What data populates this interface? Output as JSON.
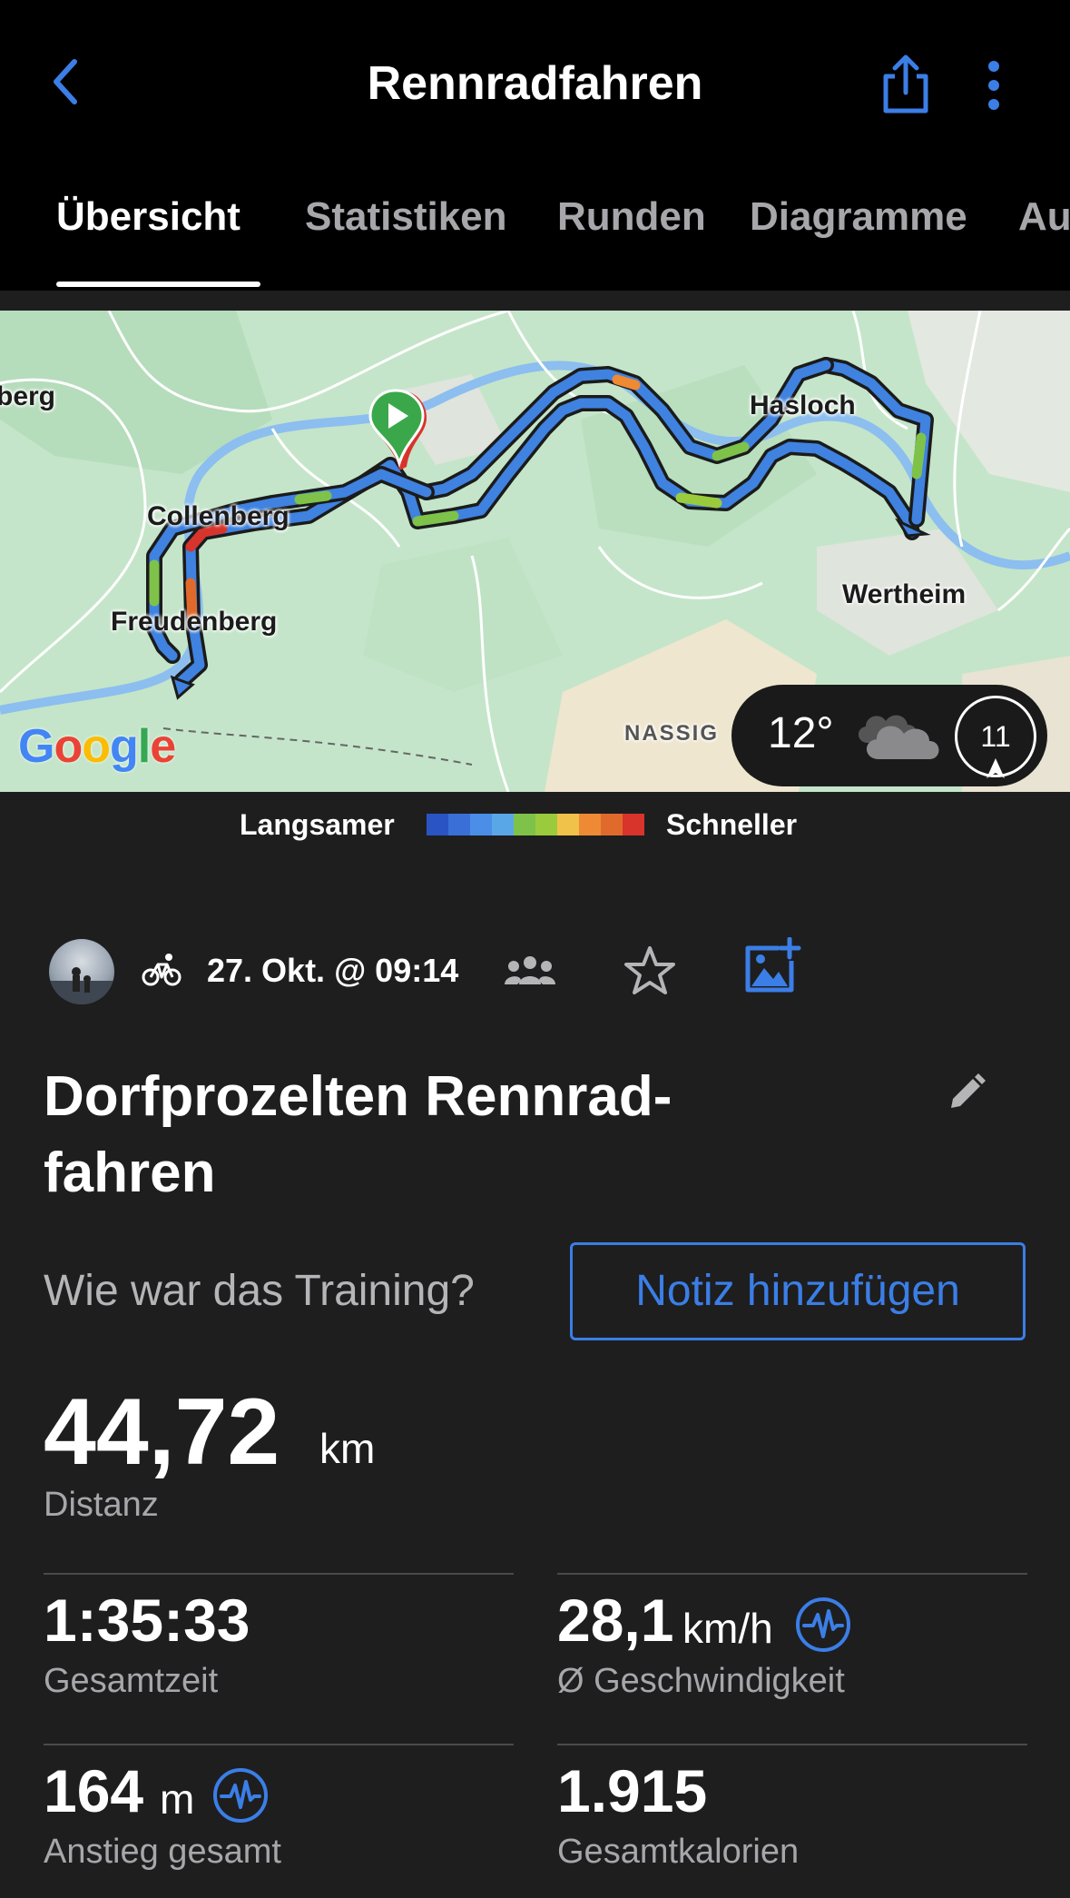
{
  "header": {
    "title": "Rennradfahren"
  },
  "tabs": [
    {
      "label": "Übersicht",
      "active": true
    },
    {
      "label": "Statistiken",
      "active": false
    },
    {
      "label": "Runden",
      "active": false
    },
    {
      "label": "Diagramme",
      "active": false
    },
    {
      "label": "Au",
      "active": false
    }
  ],
  "map": {
    "places": [
      "berg",
      "Collenberg",
      "Freudenberg",
      "Hasloch",
      "Wertheim",
      "NASSIG"
    ],
    "attribution": "Google",
    "weather": {
      "temperature": "12°",
      "wind": "11",
      "icon": "cloud-icon"
    }
  },
  "legend": {
    "slow_label": "Langsamer",
    "fast_label": "Schneller",
    "colors": [
      "#2a54c4",
      "#3a6fd8",
      "#4a8ee8",
      "#5aa7e8",
      "#7fc24a",
      "#9acb3c",
      "#f0c24a",
      "#ee8a34",
      "#e06a2c",
      "#d8342c"
    ]
  },
  "activity": {
    "date": "27. Okt. @ 09:14",
    "name": "Dorfprozelten Rennrad-fahren",
    "feeling_prompt": "Wie war das Training?",
    "note_button": "Notiz hinzufügen"
  },
  "stats": {
    "distance": {
      "value": "44,72",
      "unit": "km",
      "label": "Distanz"
    },
    "total_time": {
      "value": "1:35:33",
      "label": "Gesamtzeit"
    },
    "avg_speed": {
      "value": "28,1",
      "unit": "km/h",
      "label": "Ø Geschwindigkeit"
    },
    "ascent": {
      "value": "164",
      "unit": "m",
      "label": "Anstieg gesamt"
    },
    "calories": {
      "value": "1.915",
      "label": "Gesamtkalorien"
    }
  },
  "colors": {
    "accent": "#3b7ee6",
    "background": "#1e1e1f",
    "header_bg": "#000000",
    "secondary_text": "#a7a7ab"
  }
}
